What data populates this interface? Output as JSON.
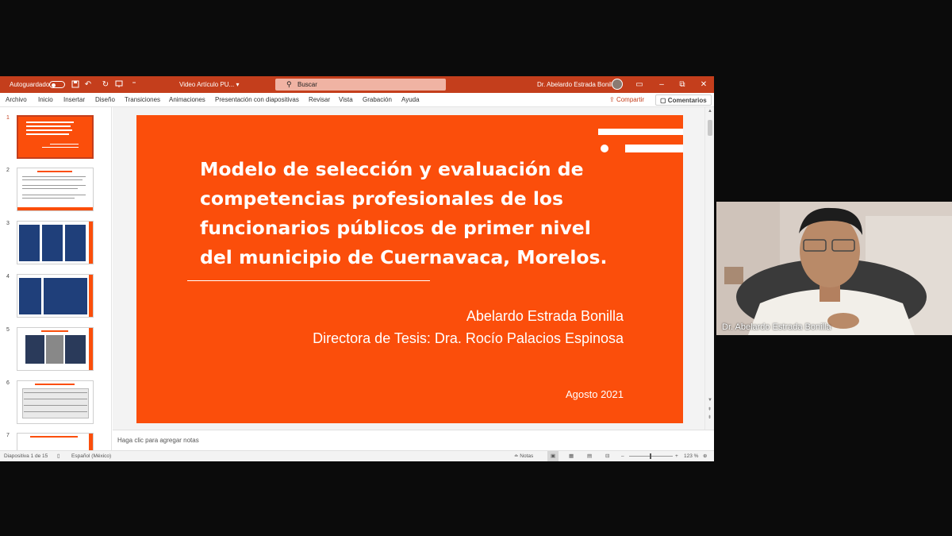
{
  "window": {
    "autosave_label": "Autoguardado",
    "doc_title": "Video Artículo PU...",
    "doc_title_caret": "▾",
    "search_placeholder": "Buscar",
    "user_name": "Dr. Abelardo Estrada Bonilla"
  },
  "menu": {
    "items": [
      "Archivo",
      "Inicio",
      "Insertar",
      "Diseño",
      "Transiciones",
      "Animaciones",
      "Presentación con diapositivas",
      "Revisar",
      "Vista",
      "Grabación",
      "Ayuda"
    ],
    "share": "Compartir",
    "comments": "Comentarios"
  },
  "thumbnails": [
    {
      "num": "1",
      "active": true
    },
    {
      "num": "2",
      "active": false
    },
    {
      "num": "3",
      "active": false
    },
    {
      "num": "4",
      "active": false
    },
    {
      "num": "5",
      "active": false
    },
    {
      "num": "6",
      "active": false
    },
    {
      "num": "7",
      "active": false
    }
  ],
  "slide": {
    "title_lines": [
      "Modelo de selección y evaluación de",
      "competencias profesionales de los",
      "funcionarios públicos de primer nivel",
      "del municipio de Cuernavaca, Morelos."
    ],
    "author": "Abelardo Estrada Bonilla",
    "director": "Directora de Tesis: Dra. Rocío Palacios Espinosa",
    "date": "Agosto 2021",
    "background_color": "#fb4e0b"
  },
  "notes": {
    "placeholder": "Haga clic para agregar notas"
  },
  "status": {
    "slide_counter": "Diapositiva 1 de 15",
    "language": "Español (México)",
    "notes_label": "Notas",
    "zoom": "123 %"
  },
  "webcam": {
    "participant_name": "Dr. Abelardo Estrada Bonilla"
  },
  "colors": {
    "accent": "#c43e1c",
    "slide_orange": "#fb4e0b"
  }
}
